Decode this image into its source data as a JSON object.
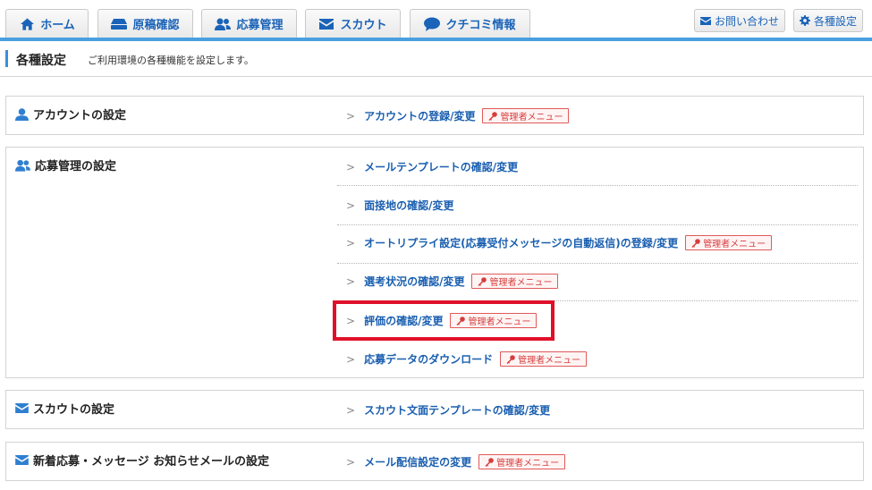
{
  "nav": {
    "tabs": [
      {
        "label": "ホーム",
        "icon": "home-icon"
      },
      {
        "label": "原稿確認",
        "icon": "document-stack-icon"
      },
      {
        "label": "応募管理",
        "icon": "users-icon"
      },
      {
        "label": "スカウト",
        "icon": "envelope-icon"
      },
      {
        "label": "クチコミ情報",
        "icon": "speech-bubble-icon"
      }
    ],
    "contact_label": "お問い合わせ",
    "settings_label": "各種設定"
  },
  "page": {
    "title": "各種設定",
    "description": "ご利用環境の各種機能を設定します。"
  },
  "admin_badge": "管理者メニュー",
  "sections": [
    {
      "title": "アカウントの設定",
      "icon": "user-icon",
      "items": [
        {
          "label": "アカウントの登録/変更",
          "admin": true
        }
      ]
    },
    {
      "title": "応募管理の設定",
      "icon": "users-icon",
      "items": [
        {
          "label": "メールテンプレートの確認/変更",
          "admin": false
        },
        {
          "label": "面接地の確認/変更",
          "admin": false
        },
        {
          "label": "オートリプライ設定(応募受付メッセージの自動返信)の登録/変更",
          "admin": true
        },
        {
          "label": "選考状況の確認/変更",
          "admin": true
        },
        {
          "label": "評価の確認/変更",
          "admin": true
        },
        {
          "label": "応募データのダウンロード",
          "admin": true
        }
      ]
    },
    {
      "title": "スカウトの設定",
      "icon": "envelope-icon",
      "items": [
        {
          "label": "スカウト文面テンプレートの確認/変更",
          "admin": false
        }
      ]
    },
    {
      "title": "新着応募・メッセージ お知らせメールの設定",
      "icon": "envelope-icon",
      "items": [
        {
          "label": "メール配信設定の変更",
          "admin": true
        }
      ]
    }
  ],
  "colors": {
    "accent": "#4a9fe0",
    "link": "#1a5fb0",
    "admin_badge": "#d63c3c",
    "highlight": "#e0102a"
  }
}
